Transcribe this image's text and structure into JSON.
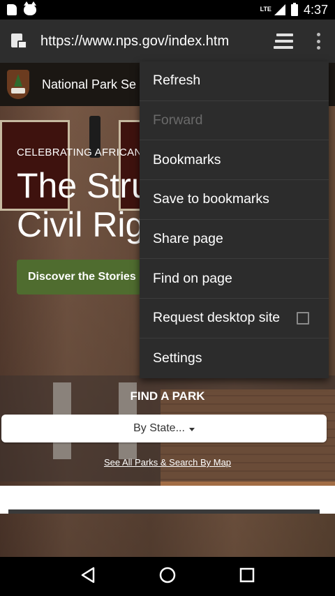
{
  "status_bar": {
    "network_label": "LTE",
    "time": "4:37"
  },
  "browser": {
    "url": "https://www.nps.gov/index.htm"
  },
  "page": {
    "site_title": "National Park Se",
    "hero_kicker": "CELEBRATING AFRICAN",
    "hero_headline": "The Stru\nCivil Rig",
    "cta_label": "Discover the Stories",
    "find_park_title": "FIND A PARK",
    "state_select_value": "By State...",
    "see_all_link": "See All Parks & Search By Map"
  },
  "menu": {
    "items": [
      {
        "label": "Refresh",
        "enabled": true
      },
      {
        "label": "Forward",
        "enabled": false
      },
      {
        "label": "Bookmarks",
        "enabled": true
      },
      {
        "label": "Save to bookmarks",
        "enabled": true
      },
      {
        "label": "Share page",
        "enabled": true
      },
      {
        "label": "Find on page",
        "enabled": true
      },
      {
        "label": "Request desktop site",
        "enabled": true,
        "checked": false
      },
      {
        "label": "Settings",
        "enabled": true
      }
    ]
  },
  "icons": {
    "status": [
      "sd-card-icon",
      "cat-notification-icon",
      "signal-icon",
      "battery-icon"
    ],
    "toolbar": [
      "site-info-lock-icon",
      "tabs-switcher-icon",
      "overflow-menu-icon"
    ],
    "nav": [
      "back-icon",
      "home-icon",
      "recents-icon"
    ]
  },
  "colors": {
    "toolbar": "#2d2d2d",
    "menu_background": "#2c2c2c",
    "menu_disabled_text": "#6a6a6a",
    "cta_green": "#4f6c2f"
  }
}
